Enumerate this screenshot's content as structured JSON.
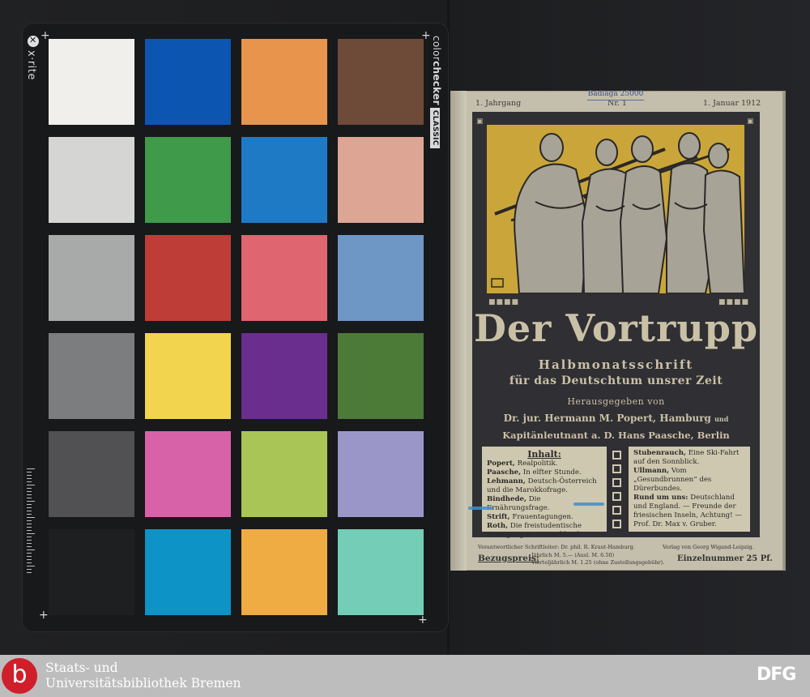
{
  "checker": {
    "brand": "x·rite",
    "product_prefix": "color",
    "product_bold": "checker",
    "product_badge": "CLASSIC",
    "patches": [
      [
        "#f0efeb",
        "#0c55b0",
        "#e9944c",
        "#6e4a39"
      ],
      [
        "#d5d5d3",
        "#3f9a4a",
        "#1f7ac6",
        "#dca594"
      ],
      [
        "#a8a9a9",
        "#bf3d37",
        "#df6570",
        "#6f97c6"
      ],
      [
        "#7c7d7f",
        "#f3d44f",
        "#6a2e8e",
        "#4c7a37"
      ],
      [
        "#515154",
        "#d762a8",
        "#a8c556",
        "#9a97c8"
      ],
      [
        "#1e1f21",
        "#0d93c5",
        "#eeac43",
        "#74cdb7"
      ]
    ]
  },
  "magazine": {
    "volume": "1. Jahrgang",
    "number": "Nr. 1",
    "date": "1. Januar 1912",
    "stamp": "Badiaga 25000",
    "title": "Der Vortrupp",
    "subtitle_1": "Halbmonatsschrift",
    "subtitle_2": "für das Deutschtum unsrer Zeit",
    "editors_intro": "Herausgegeben von",
    "editor_1": "Dr. jur. Hermann M. Popert, Hamburg",
    "editor_1_and": "und",
    "editor_2": "Kapitänleutnant a. D. Hans Paasche, Berlin",
    "contents_heading": "Inhalt:",
    "contents_left": [
      {
        "author": "Popert,",
        "text": "Realpolitik."
      },
      {
        "author": "Paasche,",
        "text": "In elfter Stunde."
      },
      {
        "author": "Lehmann,",
        "text": "Deutsch-Österreich und die Marokkofrage."
      },
      {
        "author": "Bindhede,",
        "text": "Die Ernährungsfrage."
      },
      {
        "author": "Strift,",
        "text": "Frauentagungen."
      },
      {
        "author": "Roth,",
        "text": "Die freistudentische Bewegung in Deutschland."
      }
    ],
    "contents_right": [
      {
        "author": "Stubenrauch,",
        "text": "Eine Ski-Fahrt auf den Sonnblick."
      },
      {
        "author": "Ullmann,",
        "text": "Vom „Gesundbrunnen“ des Dürerbundes."
      },
      {
        "author": "Rund um uns:",
        "text": "Deutschland und England. — Freunde der friesischen Inseln, Achtung! — Prof. Dr. Max v. Gruber."
      }
    ],
    "editor_in_charge": "Verantwortlicher Schriftleiter: Dr. phil. R. Kraut-Hamburg.",
    "publisher": "Verlag von Georg Wigand-Leipzig.",
    "price_label": "Bezugspreis:",
    "price_1": "Jährlich M. 5.— (Ausl. M. 6.50)",
    "price_2": "Vierteljährlich M. 1.25 (ohne Zustellungsgebühr).",
    "single_issue": "Einzelnummer 25 Pf.",
    "colors": {
      "cover": "#c4bfad",
      "panel": "#302f33",
      "illustration": "#caa63a",
      "ink": "#c9c1a6"
    }
  },
  "library": {
    "logo_letter": "b",
    "name_line_1": "Staats- und",
    "name_line_2": "Universitätsbibliothek Bremen",
    "funder": "DFG",
    "logo_color": "#cf1f2a"
  }
}
